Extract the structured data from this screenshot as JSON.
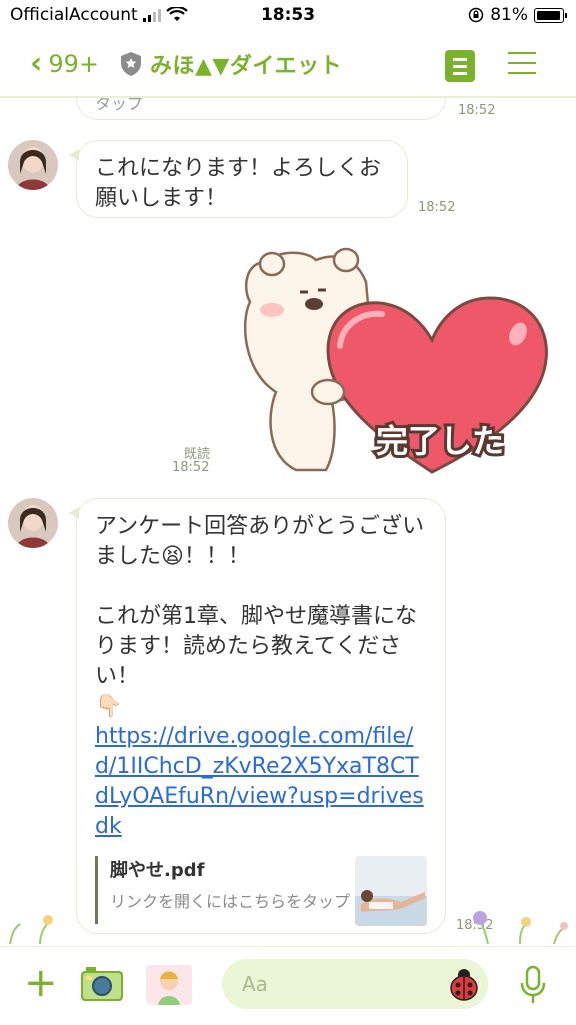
{
  "status_bar": {
    "carrier": "OfficialAccount",
    "time": "18:53",
    "battery": "81%"
  },
  "header": {
    "back_count": "99+",
    "title": "みほ▲▼ダイエット"
  },
  "messages": [
    {
      "sender": "other",
      "partial_text": "タップ",
      "time": "18:52"
    },
    {
      "sender": "other",
      "text": "これになります！よろしくお願いします！",
      "time": "18:52"
    },
    {
      "sender": "me",
      "type": "sticker",
      "sticker_text": "完了した",
      "read_label": "既読",
      "time": "18:52"
    },
    {
      "sender": "other",
      "line1": "アンケート回答ありがとうございました😫！！！",
      "line2": "これが第1章、脚やせ魔導書になります！読めたら教えてください！",
      "emoji": "👇🏻",
      "link": "https://drive.google.com/file/d/1IIChcD_zKvRe2X5YxaT8CTdLyOAEfuRn/view?usp=drivesdk",
      "preview": {
        "title": "脚やせ.pdf",
        "description": "リンクを開くにはこちらをタップ"
      },
      "time": "18:52"
    }
  ],
  "input": {
    "placeholder": "Aa"
  },
  "colors": {
    "accent": "#7ab32b",
    "input_bg": "#eaf6d6",
    "link": "#2a6bd6"
  },
  "icons": [
    "back-chevron-icon",
    "shield-icon",
    "notes-icon",
    "menu-icon",
    "plus-icon",
    "camera-icon",
    "sticker-icon",
    "ladybug-icon",
    "mic-icon"
  ]
}
